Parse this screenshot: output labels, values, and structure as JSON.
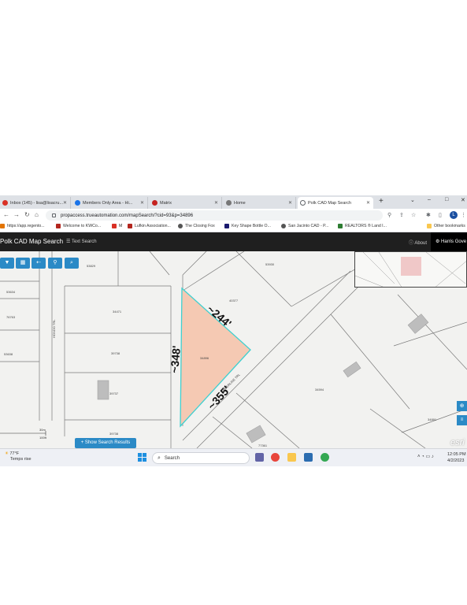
{
  "browser": {
    "tabs": [
      {
        "label": "Inbox (145) - lisa@lisacru...",
        "icon_color": "#d93025"
      },
      {
        "label": "Members Only Area - Hi...",
        "icon_color": "#1a73e8"
      },
      {
        "label": "Matrix",
        "icon_color": "#c5221f"
      },
      {
        "label": "Home",
        "icon_color": "#777777"
      },
      {
        "label": "Polk CAD Map Search",
        "icon_color": "#5f6368"
      }
    ],
    "active_tab_index": 4,
    "new_tab": "+",
    "window_controls": [
      "⌄",
      "–",
      "□",
      "✕"
    ],
    "url": "propaccess.trueautomation.com/mapSearch/?cid=93&p=34896",
    "profile_initial": "L",
    "bookmarks": [
      {
        "label": "https://app.regento...",
        "icon_color": "#e37400"
      },
      {
        "label": "Welcome to KWCo...",
        "icon_color": "#b3261e"
      },
      {
        "label": "M",
        "icon_color": "#d93025"
      },
      {
        "label": "Lufkin Association...",
        "icon_color": "#b3261e"
      },
      {
        "label": "The Closing Fox",
        "icon_color": "#555555"
      },
      {
        "label": "Key Shape Bottle O...",
        "icon_color": "#1a1a6e"
      },
      {
        "label": "San Jacinto CAD - P...",
        "icon_color": "#555555"
      },
      {
        "label": "REALTORS ® Land I...",
        "icon_color": "#2e7d32"
      },
      {
        "label": "Other bookmarks",
        "icon_color": "#f9c74f"
      }
    ]
  },
  "app": {
    "title": "Polk CAD Map Search",
    "text_search": "Text Search",
    "about": "About",
    "county": "Harris Gove"
  },
  "map": {
    "tool_icons": [
      "select-icon",
      "map-icon",
      "back-icon",
      "pin-icon",
      "search-icon"
    ],
    "tool_glyphs": [
      "▼",
      "▦",
      "⇠",
      "⚲",
      "⌕"
    ],
    "parcel_labels": [
      "53829",
      "53930",
      "40377",
      "53634",
      "76763",
      "34471",
      "53638",
      "39738",
      "39737",
      "34896",
      "34594",
      "34891",
      "77361",
      "39738"
    ],
    "road_labels": [
      "TIMBERLINE TRL",
      "HONDO TRL"
    ],
    "dimensions": [
      "~244'",
      "~348'",
      "~355'"
    ],
    "scale_labels": [
      "30m",
      "100ft"
    ],
    "show_results": "Show Search Results",
    "esri": "esri",
    "highlight_color": "#f5c9b3",
    "outline_color": "#3fd0d0"
  },
  "taskbar": {
    "temperature": "77°F",
    "weather_text": "Temps rise",
    "search_placeholder": "Search",
    "time": "12:05 PM",
    "date": "4/2/2023"
  }
}
